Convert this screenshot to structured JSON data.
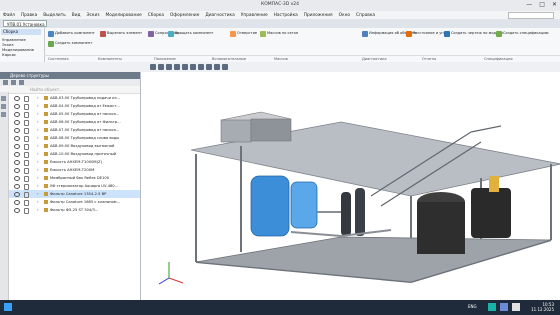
{
  "window": {
    "title": "КОМПАС-3D v24",
    "controls": [
      "—",
      "□",
      "✕"
    ]
  },
  "menu": [
    "Файл",
    "Правка",
    "Выделить",
    "Вид",
    "Эскиз",
    "Моделирование",
    "Сборка",
    "Оформление",
    "Диагностика",
    "Управление",
    "Настройка",
    "Приложения",
    "Окно",
    "Справка"
  ],
  "document_tab": "УПВ.01 Установка в...",
  "ribbon_left": {
    "selected": "Сборка",
    "items": [
      "Управление",
      "Эскиз",
      "Моделирование",
      "Каркас"
    ]
  },
  "ribbon_buttons": [
    "Добавить компонент",
    "Создать компонент",
    "Вырезать элемент",
    "Сопряжения",
    "Вращать компонент",
    "Отверстие",
    "Массив по сетке",
    "Информация об объекте",
    "Расстояние и угол",
    "Создать чертеж по модели",
    "Создать спецификацию"
  ],
  "ribbon_sections": [
    "Системная",
    "Компоненты",
    "Положение",
    "Вспомогательные",
    "Массив",
    "Диагностика",
    "Отчеты",
    "Спецификация"
  ],
  "tree": {
    "header": "Дерево структуры",
    "filter_placeholder": "Найти объект...",
    "rows": [
      {
        "label": "АБВ.03.00 Трубопровод подачи из...",
        "selected": false
      },
      {
        "label": "АБВ.04.00 Трубопровод от Емкост...",
        "selected": false
      },
      {
        "label": "АБВ.05.00 Трубопровод от насоса...",
        "selected": false
      },
      {
        "label": "АБВ.06.00 Трубопровод от Фильтр...",
        "selected": false
      },
      {
        "label": "АБВ.07.00 Трубопровод от насоса...",
        "selected": false
      },
      {
        "label": "АБВ.08.00 Трубопровод слива воды",
        "selected": false
      },
      {
        "label": "АБВ.09.00 Воздуховод вытяжной",
        "selected": false
      },
      {
        "label": "АБВ.10.00 Воздуховод приточный",
        "selected": false
      },
      {
        "label": "Емкость АНХЕМ-Т1000M(Z)",
        "selected": false
      },
      {
        "label": "Емкость АНХЕМ-Т200M",
        "selected": false
      },
      {
        "label": "Мембранный бак Reflex DE100",
        "selected": false
      },
      {
        "label": "УФ стерилизатор Aquapro UV-480...",
        "selected": false
      },
      {
        "label": "Фильтр Canature 1354-2.5 ВР",
        "selected": true
      },
      {
        "label": "Фильтр Canature 1665 с клапаном...",
        "selected": false
      },
      {
        "label": "Фильтр ФЗ-25 ST 304/3...",
        "selected": false
      }
    ]
  },
  "taskbar": {
    "lang": "ENG",
    "time": "10:53",
    "date": "11.12.2025"
  }
}
